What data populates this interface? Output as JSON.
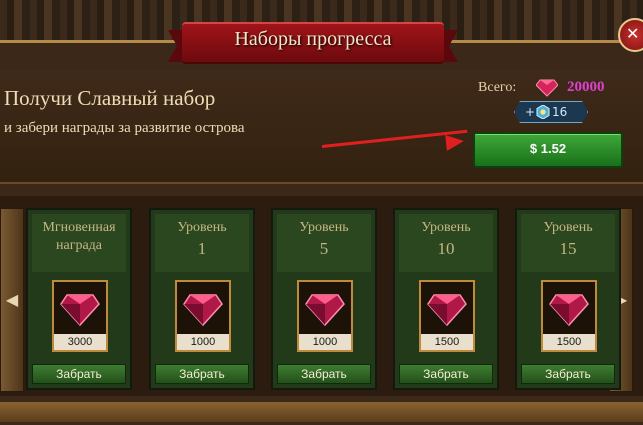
{
  "window": {
    "title": "Наборы прогресса",
    "close_icon": "close-icon"
  },
  "offer": {
    "title": "Получи Славный набор",
    "subtitle": "и забери награды за развитие острова",
    "total_label": "Всего:",
    "total_value": "20000",
    "total_currency_icon": "ruby-icon",
    "bonus_prefix": "+",
    "bonus_value": "16",
    "bonus_icon": "gem-hex-icon",
    "buy_label": "$ 1.52"
  },
  "nav": {
    "prev_icon": "arrow-left-icon",
    "next_icon": "arrow-right-icon"
  },
  "cards": [
    {
      "line1": "Мгновенная",
      "line2": "награда",
      "amount": "3000",
      "button": "Забрать"
    },
    {
      "line1": "Уровень",
      "line2": "1",
      "amount": "1000",
      "button": "Забрать"
    },
    {
      "line1": "Уровень",
      "line2": "5",
      "amount": "1000",
      "button": "Забрать"
    },
    {
      "line1": "Уровень",
      "line2": "10",
      "amount": "1500",
      "button": "Забрать"
    },
    {
      "line1": "Уровень",
      "line2": "15",
      "amount": "1500",
      "button": "Забрать"
    }
  ],
  "colors": {
    "accent_red": "#a01419",
    "buy_green": "#3fa83a",
    "ruby": "#e040d0",
    "arrow": "#e02020"
  }
}
